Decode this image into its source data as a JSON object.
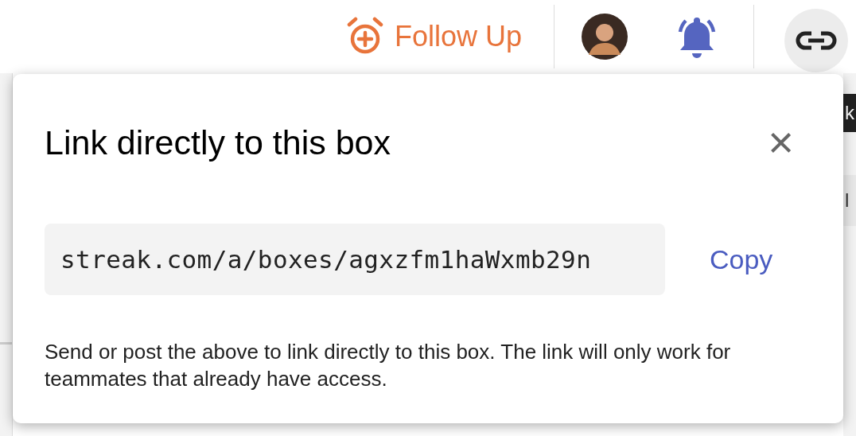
{
  "toolbar": {
    "follow_up": "Follow Up"
  },
  "background": {
    "right_fragments": [
      {
        "kind": "dark",
        "text": "k"
      },
      {
        "kind": "shaded",
        "text": "l"
      }
    ]
  },
  "popover": {
    "title": "Link directly to this box",
    "close": "×",
    "link": "streak.com/a/boxes/agxzfm1haWxmb29n",
    "copy": "Copy",
    "note": "Send or post the above to link directly to this box. The link will only work for teammates that already have access."
  }
}
